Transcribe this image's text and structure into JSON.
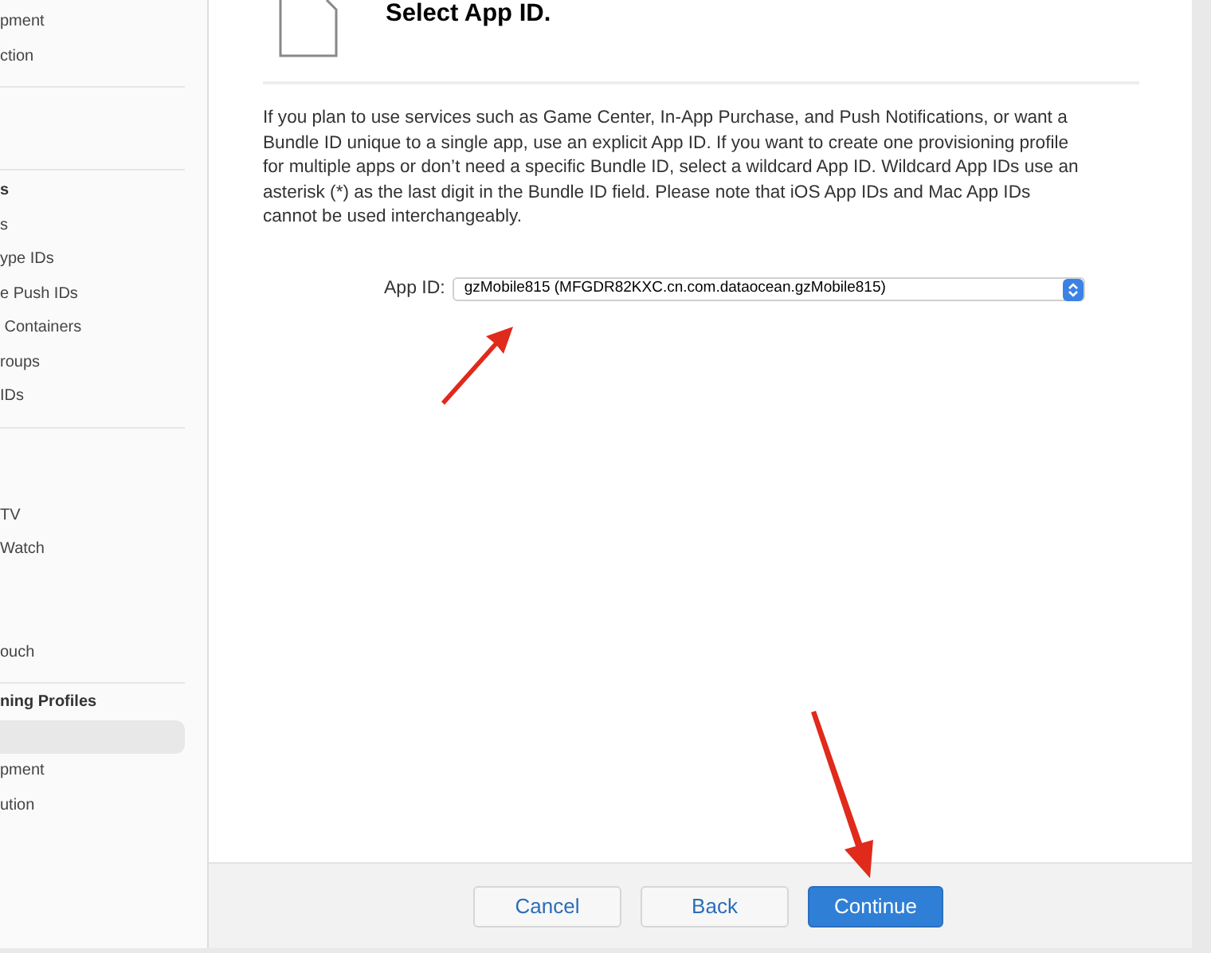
{
  "sidebar": {
    "sections": [
      {
        "items": [
          {
            "label": "pment",
            "kind": "item",
            "selected": false
          },
          {
            "label": "ction",
            "kind": "item",
            "selected": false
          }
        ]
      },
      {
        "items": [
          {
            "label": "s",
            "kind": "header",
            "selected": false
          },
          {
            "label": "s",
            "kind": "item",
            "selected": false
          },
          {
            "label": "ype IDs",
            "kind": "item",
            "selected": false
          },
          {
            "label": "e Push IDs",
            "kind": "item",
            "selected": false
          },
          {
            "label": " Containers",
            "kind": "item",
            "selected": false
          },
          {
            "label": "roups",
            "kind": "item",
            "selected": false
          },
          {
            "label": "IDs",
            "kind": "item",
            "selected": false
          }
        ]
      },
      {
        "items": [
          {
            "label": "TV",
            "kind": "item",
            "selected": false
          },
          {
            "label": "Watch",
            "kind": "item",
            "selected": false
          },
          {
            "label": "ouch",
            "kind": "item",
            "selected": false
          }
        ]
      },
      {
        "items": [
          {
            "label": "ning Profiles",
            "kind": "header",
            "selected": false
          },
          {
            "selected": true
          },
          {
            "label": "pment",
            "kind": "item",
            "selected": false
          },
          {
            "label": "ution",
            "kind": "item",
            "selected": false
          }
        ]
      }
    ]
  },
  "main": {
    "title": "Select App ID.",
    "description": "If you plan to use services such as Game Center, In-App Purchase, and Push Notifications, or want a Bundle ID unique to a single app, use an explicit App ID. If you want to create one provisioning profile for multiple apps or don’t need a specific Bundle ID, select a wildcard App ID. Wildcard App IDs use an asterisk (*) as the last digit in the Bundle ID field. Please note that iOS App IDs and Mac App IDs cannot be used interchangeably.",
    "app_id": {
      "label": "App ID:",
      "value": "gzMobile815 (MFGDR82KXC.cn.com.dataocean.gzMobile815)"
    }
  },
  "footer": {
    "buttons": [
      {
        "label": "Cancel",
        "kind": "secondary"
      },
      {
        "label": "Back",
        "kind": "secondary"
      },
      {
        "label": "Continue",
        "kind": "primary"
      }
    ]
  }
}
